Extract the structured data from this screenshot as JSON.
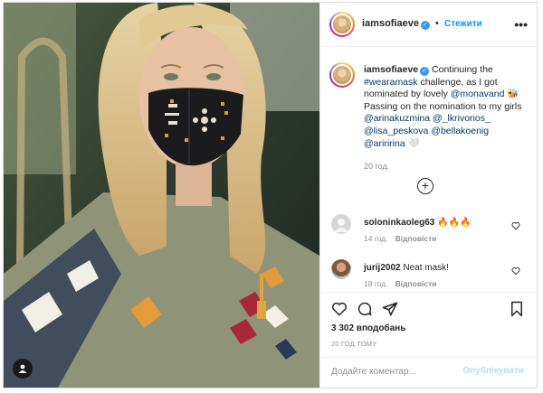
{
  "post": {
    "author": "iamsofiaeve",
    "follow_label": "Стежити",
    "more_icon": "ellipsis-icon",
    "caption": {
      "author": "iamsofiaeve",
      "text_1": "Continuing the",
      "hashtag": "#wearamask",
      "text_2": "challenge, as I got nominated by lovely",
      "mention_1": "@monavand",
      "emoji_1": "🐝",
      "text_3": "Passing on the nomination to my girls",
      "mention_2": "@arinakuzmina",
      "mention_3": "@_lkrivonos_",
      "mention_4": "@lisa_peskova",
      "mention_5": "@bellakoenig",
      "mention_6": "@ariririna",
      "emoji_2": "🤍",
      "time": "20 год."
    },
    "comments": [
      {
        "user": "soloninkaoleg63",
        "text": "🔥🔥🔥",
        "time": "14 год.",
        "reply": "Відповісти"
      },
      {
        "user": "jurij2002",
        "text": "Neat mask!",
        "time": "18 год.",
        "reply": "Відповісти"
      }
    ],
    "likes": "3 302 вподобань",
    "ago": "20 ГОД ТОМУ",
    "add_comment_placeholder": "Додайте коментар...",
    "publish_label": "Опублікувати",
    "colors": {
      "link": "#00376b",
      "accent": "#0095f6",
      "muted": "#8e8e8e"
    }
  }
}
